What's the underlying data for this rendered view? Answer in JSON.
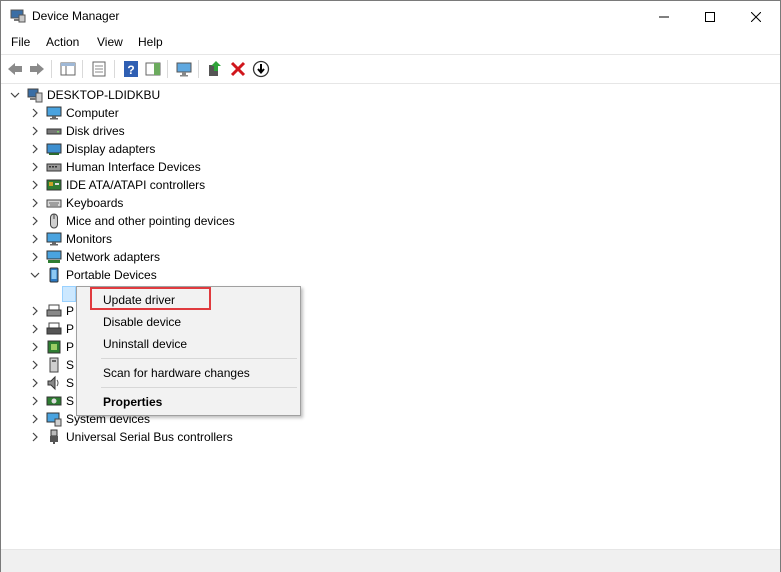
{
  "window": {
    "title": "Device Manager"
  },
  "menu": [
    "File",
    "Action",
    "View",
    "Help"
  ],
  "tree": {
    "root": "DESKTOP-LDIDKBU",
    "items": [
      {
        "label": "Computer",
        "icon": "computer-icon"
      },
      {
        "label": "Disk drives",
        "icon": "disk-drive-icon"
      },
      {
        "label": "Display adapters",
        "icon": "display-adapter-icon"
      },
      {
        "label": "Human Interface Devices",
        "icon": "hid-icon"
      },
      {
        "label": "IDE ATA/ATAPI controllers",
        "icon": "ide-controller-icon"
      },
      {
        "label": "Keyboards",
        "icon": "keyboard-icon"
      },
      {
        "label": "Mice and other pointing devices",
        "icon": "mouse-icon"
      },
      {
        "label": "Monitors",
        "icon": "monitor-icon"
      },
      {
        "label": "Network adapters",
        "icon": "network-adapter-icon"
      },
      {
        "label": "Portable Devices",
        "icon": "portable-device-icon"
      }
    ],
    "partial_items": [
      {
        "label": "System devices",
        "icon": "system-devices-icon"
      },
      {
        "label": "Universal Serial Bus controllers",
        "icon": "usb-icon"
      }
    ],
    "partial_letters": [
      "P",
      "P",
      "P",
      "S",
      "S",
      "S"
    ]
  },
  "context_menu": {
    "update": "Update driver",
    "disable": "Disable device",
    "uninstall": "Uninstall device",
    "scan": "Scan for hardware changes",
    "properties": "Properties"
  }
}
